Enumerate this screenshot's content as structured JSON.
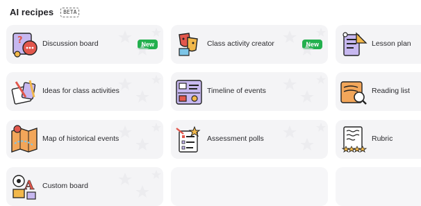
{
  "header": {
    "title": "AI recipes",
    "badge": "BETA"
  },
  "cards": [
    {
      "label": "Discussion board",
      "badge": "New",
      "icon": "discussion-board-icon"
    },
    {
      "label": "Class activity creator",
      "badge": "New",
      "icon": "class-activity-creator-icon"
    },
    {
      "label": "Lesson plan",
      "badge": "",
      "icon": "lesson-plan-icon"
    },
    {
      "label": "Ideas for class activities",
      "badge": "",
      "icon": "ideas-for-class-activities-icon"
    },
    {
      "label": "Timeline of events",
      "badge": "",
      "icon": "timeline-of-events-icon"
    },
    {
      "label": "Reading list",
      "badge": "",
      "icon": "reading-list-icon"
    },
    {
      "label": "Map of historical events",
      "badge": "",
      "icon": "map-of-historical-events-icon"
    },
    {
      "label": "Assessment polls",
      "badge": "",
      "icon": "assessment-polls-icon"
    },
    {
      "label": "Rubric",
      "badge": "",
      "icon": "rubric-icon"
    },
    {
      "label": "Custom board",
      "badge": "",
      "icon": "custom-board-icon"
    }
  ]
}
